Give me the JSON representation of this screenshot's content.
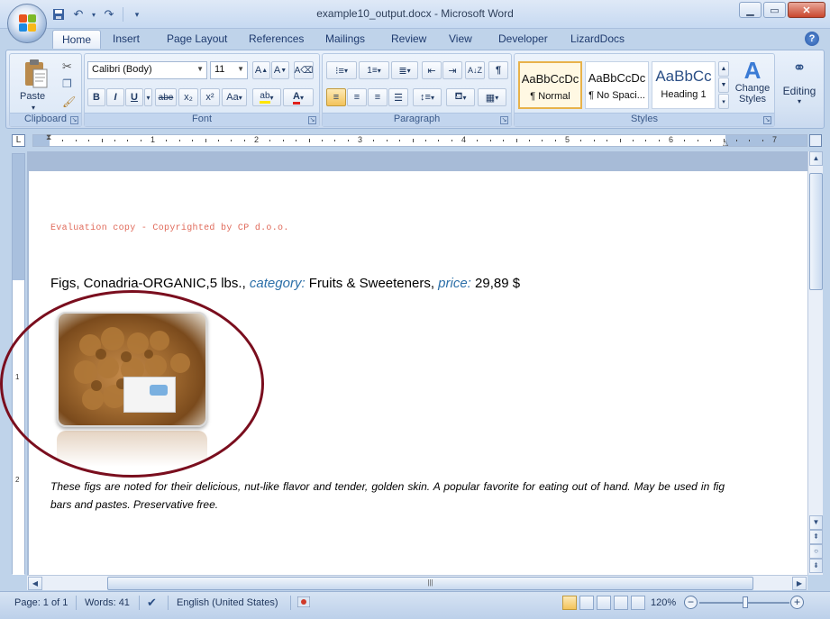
{
  "window": {
    "title": "example10_output.docx - Microsoft Word",
    "controls": [
      "minimize",
      "maximize",
      "close"
    ]
  },
  "quick_access": {
    "items": [
      "save-icon",
      "undo-icon",
      "redo-icon",
      "customize-icon"
    ]
  },
  "tabs": [
    {
      "label": "Home",
      "active": true
    },
    {
      "label": "Insert"
    },
    {
      "label": "Page Layout"
    },
    {
      "label": "References"
    },
    {
      "label": "Mailings"
    },
    {
      "label": "Review"
    },
    {
      "label": "View"
    },
    {
      "label": "Developer"
    },
    {
      "label": "LizardDocs"
    }
  ],
  "ribbon": {
    "clipboard": {
      "label": "Clipboard",
      "paste": "Paste"
    },
    "font": {
      "label": "Font",
      "family": "Calibri (Body)",
      "size": "11",
      "buttons": [
        "B",
        "I",
        "U",
        "abe",
        "x₂",
        "x²",
        "Aa"
      ]
    },
    "paragraph": {
      "label": "Paragraph"
    },
    "styles": {
      "label": "Styles",
      "items": [
        {
          "sample": "AaBbCcDc",
          "name": "¶ Normal"
        },
        {
          "sample": "AaBbCcDc",
          "name": "¶ No Spaci..."
        },
        {
          "sample": "AaBbCc",
          "name": "Heading 1"
        }
      ],
      "change_styles": "Change Styles"
    },
    "editing": {
      "label": "Editing"
    }
  },
  "ruler": {
    "numbers": [
      "1",
      "2",
      "3",
      "4",
      "5",
      "6",
      "7"
    ],
    "vertical_numbers": [
      "1",
      "2"
    ]
  },
  "document": {
    "eval_notice": "Evaluation copy - Copyrighted by CP d.o.o.",
    "product_name": "Figs, Conadria-ORGANIC,5 lbs., ",
    "category_label": "category:",
    "category_value": " Fruits & Sweeteners, ",
    "price_label": "price:",
    "price_value": " 29,89 $",
    "description": "These figs are noted for their delicious, nut-like flavor and tender, golden skin. A popular favorite for eating out of hand. May be used in fig bars and pastes. Preservative free."
  },
  "status": {
    "page": "Page: 1 of 1",
    "words": "Words: 41",
    "language": "English (United States)",
    "zoom": "120%",
    "zoom_value": 120
  },
  "colors": {
    "accent": "#2c6fa8",
    "eval": "#e06a5a",
    "annotation": "#7a0e1e"
  }
}
